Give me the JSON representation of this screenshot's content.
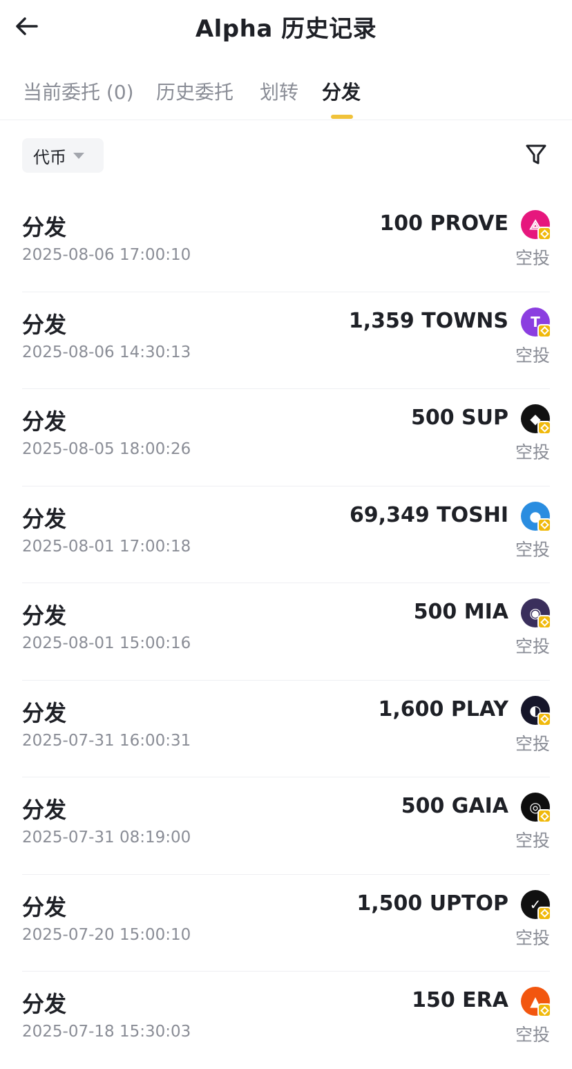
{
  "header": {
    "title": "Alpha 历史记录"
  },
  "tabs": [
    {
      "label": "当前委托 (0)",
      "active": false
    },
    {
      "label": "历史委托",
      "active": false
    },
    {
      "label": "划转",
      "active": false
    },
    {
      "label": "分发",
      "active": true
    }
  ],
  "filter": {
    "coin_label": "代币"
  },
  "colors": {
    "accent": "#f0c23a",
    "text": "#1e2026",
    "muted": "#8a8d96",
    "badge": "#f0b90b"
  },
  "records": [
    {
      "type": "分发",
      "time": "2025-08-06 17:00:10",
      "amount": "100 PROVE",
      "kind": "空投",
      "icon": "prove-token-icon",
      "icon_color": "#e6177d"
    },
    {
      "type": "分发",
      "time": "2025-08-06 14:30:13",
      "amount": "1,359 TOWNS",
      "kind": "空投",
      "icon": "towns-token-icon",
      "icon_color": "#8b3ee0"
    },
    {
      "type": "分发",
      "time": "2025-08-05 18:00:26",
      "amount": "500 SUP",
      "kind": "空投",
      "icon": "sup-token-icon",
      "icon_color": "#111111"
    },
    {
      "type": "分发",
      "time": "2025-08-01 17:00:18",
      "amount": "69,349 TOSHI",
      "kind": "空投",
      "icon": "toshi-token-icon",
      "icon_color": "#2a8de0"
    },
    {
      "type": "分发",
      "time": "2025-08-01 15:00:16",
      "amount": "500 MIA",
      "kind": "空投",
      "icon": "mia-token-icon",
      "icon_color": "#3a2f5c"
    },
    {
      "type": "分发",
      "time": "2025-07-31 16:00:31",
      "amount": "1,600 PLAY",
      "kind": "空投",
      "icon": "play-token-icon",
      "icon_color": "#16162a"
    },
    {
      "type": "分发",
      "time": "2025-07-31 08:19:00",
      "amount": "500 GAIA",
      "kind": "空投",
      "icon": "gaia-token-icon",
      "icon_color": "#0e0e0e"
    },
    {
      "type": "分发",
      "time": "2025-07-20 15:00:10",
      "amount": "1,500 UPTOP",
      "kind": "空投",
      "icon": "uptop-token-icon",
      "icon_color": "#111111"
    },
    {
      "type": "分发",
      "time": "2025-07-18 15:30:03",
      "amount": "150 ERA",
      "kind": "空投",
      "icon": "era-token-icon",
      "icon_color": "#f2560f"
    }
  ]
}
